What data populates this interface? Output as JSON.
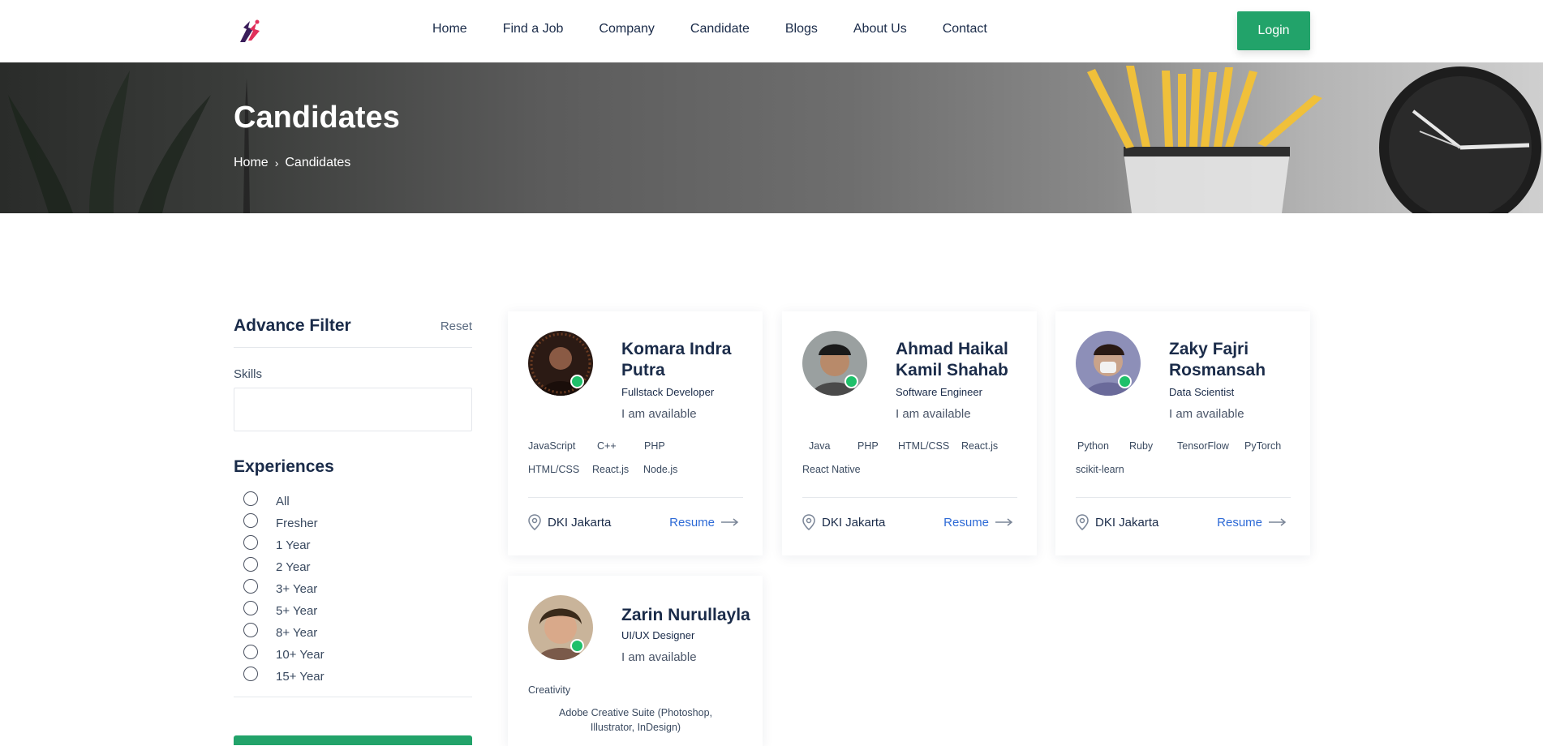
{
  "nav": {
    "links": [
      "Home",
      "Find a Job",
      "Company",
      "Candidate",
      "Blogs",
      "About Us",
      "Contact"
    ],
    "login": "Login"
  },
  "hero": {
    "title": "Candidates",
    "breadcrumb": [
      "Home",
      "Candidates"
    ]
  },
  "filter": {
    "title": "Advance Filter",
    "reset": "Reset",
    "skills_label": "Skills",
    "skills_value": "",
    "experiences_title": "Experiences",
    "experiences": [
      "All",
      "Fresher",
      "1 Year",
      "2 Year",
      "3+ Year",
      "5+ Year",
      "8+ Year",
      "10+ Year",
      "15+ Year"
    ]
  },
  "candidates": [
    {
      "name": "Komara Indra Putra",
      "role": "Fullstack Developer",
      "status": "I am available",
      "skills": [
        "JavaScript",
        "C++",
        "PHP",
        "HTML/CSS",
        "React.js",
        "Node.js"
      ],
      "location": "DKI Jakarta",
      "action": "Resume"
    },
    {
      "name": "Ahmad Haikal Kamil Shahab",
      "role": "Software Engineer",
      "status": "I am available",
      "skills": [
        "Java",
        "PHP",
        "HTML/CSS",
        "React.js",
        "React Native"
      ],
      "location": "DKI Jakarta",
      "action": "Resume"
    },
    {
      "name": "Zaky Fajri Rosmansah",
      "role": "Data Scientist",
      "status": "I am available",
      "skills": [
        "Python",
        "Ruby",
        "TensorFlow",
        "PyTorch",
        "scikit-learn"
      ],
      "location": "DKI Jakarta",
      "action": "Resume"
    },
    {
      "name": "Zarin Nurullayla",
      "role": "UI/UX Designer",
      "status": "I am available",
      "skills": [
        "Creativity",
        "Adobe Creative Suite (Photoshop, Illustrator, InDesign)"
      ]
    }
  ],
  "colors": {
    "accent": "#22a36a",
    "link": "#2d6ad6",
    "text": "#1a2b49",
    "online": "#1fc06a"
  }
}
